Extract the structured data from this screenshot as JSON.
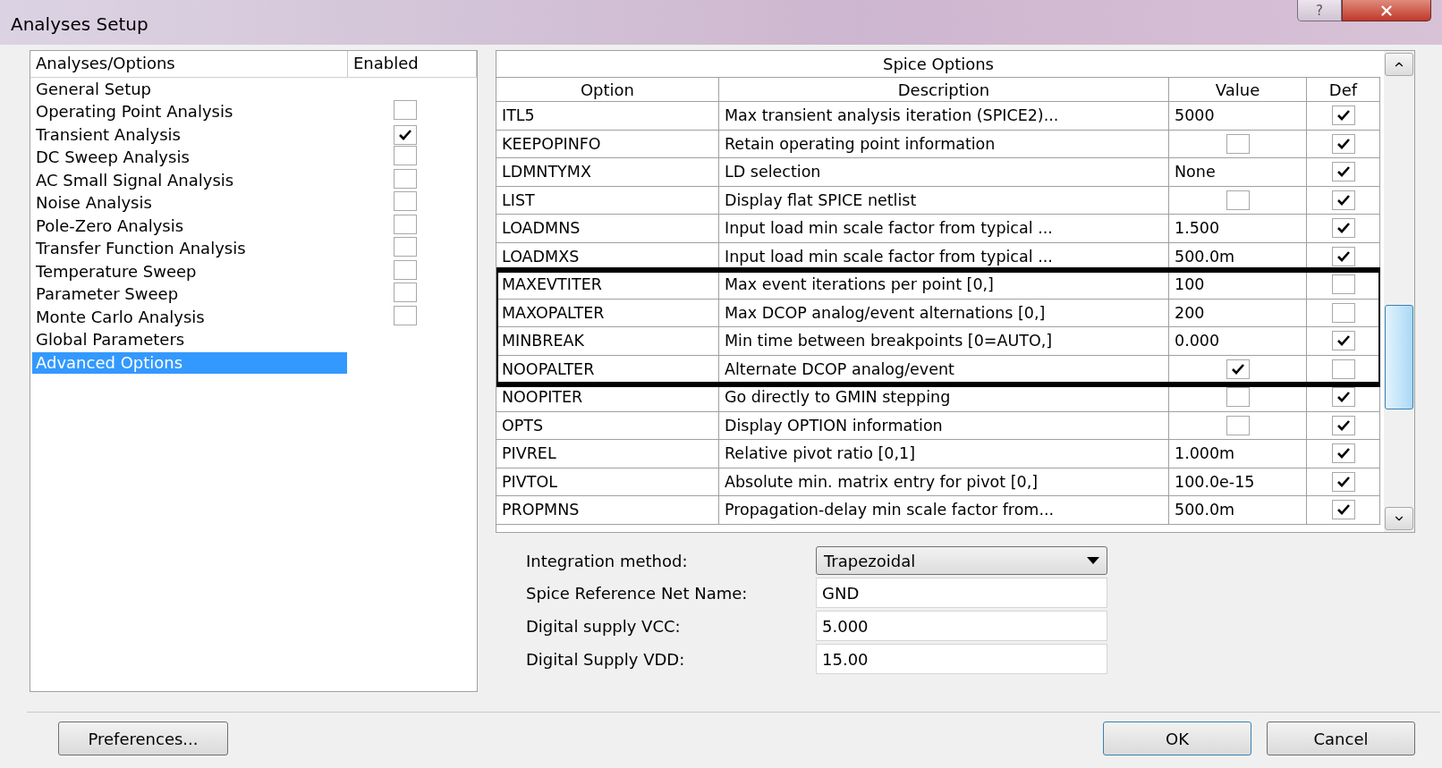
{
  "window": {
    "title": "Analyses Setup",
    "help_button": "?"
  },
  "analyses": {
    "columns": [
      "Analyses/Options",
      "Enabled"
    ],
    "items": [
      {
        "label": "General Setup",
        "kind": "plain",
        "selected": false
      },
      {
        "label": "Operating Point Analysis",
        "kind": "check",
        "checked": false,
        "selected": false
      },
      {
        "label": "Transient Analysis",
        "kind": "check",
        "checked": true,
        "selected": false
      },
      {
        "label": "DC Sweep Analysis",
        "kind": "check",
        "checked": false,
        "selected": false
      },
      {
        "label": "AC Small Signal Analysis",
        "kind": "check",
        "checked": false,
        "selected": false
      },
      {
        "label": "Noise Analysis",
        "kind": "check",
        "checked": false,
        "selected": false
      },
      {
        "label": "Pole-Zero Analysis",
        "kind": "check",
        "checked": false,
        "selected": false
      },
      {
        "label": "Transfer Function Analysis",
        "kind": "check",
        "checked": false,
        "selected": false
      },
      {
        "label": "Temperature Sweep",
        "kind": "check",
        "checked": false,
        "selected": false
      },
      {
        "label": "Parameter Sweep",
        "kind": "check",
        "checked": false,
        "selected": false
      },
      {
        "label": "Monte Carlo Analysis",
        "kind": "check",
        "checked": false,
        "selected": false
      },
      {
        "label": "Global Parameters",
        "kind": "plain",
        "selected": false
      },
      {
        "label": "Advanced Options",
        "kind": "plain",
        "selected": true
      }
    ]
  },
  "spice_options": {
    "title": "Spice Options",
    "columns": [
      "Option",
      "Description",
      "Value",
      "Def"
    ],
    "rows": [
      {
        "option": "ITL5",
        "description": "Max transient analysis iteration (SPICE2)...",
        "value": {
          "kind": "text",
          "text": "5000"
        },
        "def": true,
        "outlined": false
      },
      {
        "option": "KEEPOPINFO",
        "description": "Retain operating point information",
        "value": {
          "kind": "check",
          "checked": false
        },
        "def": true,
        "outlined": false
      },
      {
        "option": "LDMNTYMX",
        "description": "LD selection",
        "value": {
          "kind": "text",
          "text": "None"
        },
        "def": true,
        "outlined": false
      },
      {
        "option": "LIST",
        "description": "Display flat SPICE netlist",
        "value": {
          "kind": "check",
          "checked": false
        },
        "def": true,
        "outlined": false
      },
      {
        "option": "LOADMNS",
        "description": "Input load min scale factor from typical ...",
        "value": {
          "kind": "text",
          "text": "1.500"
        },
        "def": true,
        "outlined": false
      },
      {
        "option": "LOADMXS",
        "description": "Input load min scale factor from typical ...",
        "value": {
          "kind": "text",
          "text": "500.0m"
        },
        "def": true,
        "outlined": false
      },
      {
        "option": "MAXEVTITER",
        "description": "Max event iterations per point [0,]",
        "value": {
          "kind": "text",
          "text": "100"
        },
        "def": false,
        "outlined": true
      },
      {
        "option": "MAXOPALTER",
        "description": "Max DCOP analog/event alternations [0,]",
        "value": {
          "kind": "text",
          "text": "200"
        },
        "def": false,
        "outlined": true
      },
      {
        "option": "MINBREAK",
        "description": "Min time between breakpoints [0=AUTO,]",
        "value": {
          "kind": "text",
          "text": "0.000"
        },
        "def": true,
        "outlined": true
      },
      {
        "option": "NOOPALTER",
        "description": "Alternate DCOP analog/event",
        "value": {
          "kind": "check",
          "checked": true
        },
        "def": false,
        "outlined": true
      },
      {
        "option": "NOOPITER",
        "description": "Go directly to GMIN stepping",
        "value": {
          "kind": "check",
          "checked": false
        },
        "def": true,
        "outlined": false
      },
      {
        "option": "OPTS",
        "description": "Display OPTION information",
        "value": {
          "kind": "check",
          "checked": false
        },
        "def": true,
        "outlined": false
      },
      {
        "option": "PIVREL",
        "description": "Relative pivot ratio [0,1]",
        "value": {
          "kind": "text",
          "text": "1.000m"
        },
        "def": true,
        "outlined": false
      },
      {
        "option": "PIVTOL",
        "description": "Absolute min. matrix entry for pivot [0,]",
        "value": {
          "kind": "text",
          "text": "100.0e-15"
        },
        "def": true,
        "outlined": false
      },
      {
        "option": "PROPMNS",
        "description": "Propagation-delay min scale factor from...",
        "value": {
          "kind": "text",
          "text": "500.0m"
        },
        "def": true,
        "outlined": false
      }
    ]
  },
  "settings": [
    {
      "label": "Integration method:",
      "kind": "dropdown",
      "value": "Trapezoidal"
    },
    {
      "label": "Spice Reference Net Name:",
      "kind": "input",
      "value": "GND"
    },
    {
      "label": "Digital supply VCC:",
      "kind": "input",
      "value": "5.000"
    },
    {
      "label": "Digital Supply VDD:",
      "kind": "input",
      "value": "15.00"
    }
  ],
  "buttons": {
    "preferences": "Preferences...",
    "ok": "OK",
    "cancel": "Cancel"
  }
}
